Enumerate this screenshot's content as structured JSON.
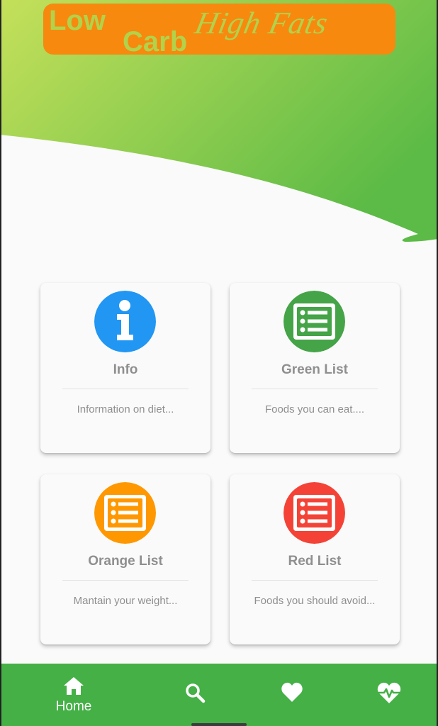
{
  "header": {
    "logo": {
      "word1": "Low",
      "word2": "Carb",
      "script": "High Fats",
      "banner_color": "#f7890f",
      "text_color": "#b2d24a"
    },
    "gradient": [
      "#c5e05a",
      "#5cbb46"
    ]
  },
  "cards": [
    {
      "title": "Info",
      "description": "Information on diet...",
      "icon": "info-icon",
      "color": "#2196f3"
    },
    {
      "title": "Green List",
      "description": "Foods you can eat....",
      "icon": "list-icon",
      "color": "#44a447"
    },
    {
      "title": "Orange List",
      "description": "Mantain your weight...",
      "icon": "list-icon",
      "color": "#ff9800"
    },
    {
      "title": "Red List",
      "description": "Foods you should avoid...",
      "icon": "list-icon",
      "color": "#f44336"
    }
  ],
  "bottom_nav": {
    "background": "#44b046",
    "items": [
      {
        "label": "Home",
        "icon": "home-icon",
        "active": true
      },
      {
        "label": "",
        "icon": "search-icon",
        "active": false
      },
      {
        "label": "",
        "icon": "heart-icon",
        "active": false
      },
      {
        "label": "",
        "icon": "heartbeat-icon",
        "active": false
      }
    ]
  }
}
